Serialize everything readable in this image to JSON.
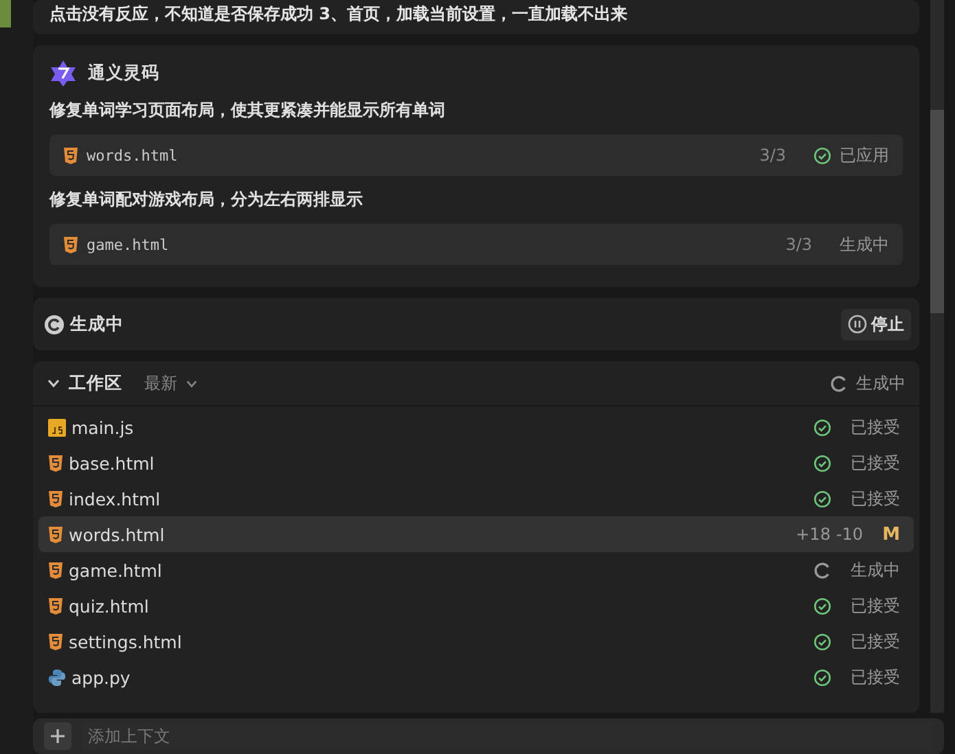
{
  "message": {
    "text": "点击没有反应，不知道是否保存成功 3、首页，加载当前设置，一直加载不出来"
  },
  "reply": {
    "author": "通义灵码",
    "tasks": [
      {
        "title": "修复单词学习页面布局，使其更紧凑并能显示所有单词",
        "file": "words.html",
        "count": "3/3",
        "status": "已应用",
        "kind": "applied"
      },
      {
        "title": "修复单词配对游戏布局，分为左右两排显示",
        "file": "game.html",
        "count": "3/3",
        "status": "生成中",
        "kind": "generating"
      }
    ]
  },
  "status_bar": {
    "label": "生成中",
    "stop": "停止"
  },
  "workspace": {
    "title": "工作区",
    "sort": "最新",
    "expanded": true,
    "status": "生成中",
    "files": [
      {
        "name": "main.js",
        "kind": "js",
        "status": {
          "kind": "accepted",
          "text": "已接受"
        },
        "selected": false
      },
      {
        "name": "base.html",
        "kind": "html",
        "status": {
          "kind": "accepted",
          "text": "已接受"
        },
        "selected": false
      },
      {
        "name": "index.html",
        "kind": "html",
        "status": {
          "kind": "accepted",
          "text": "已接受"
        },
        "selected": false
      },
      {
        "name": "words.html",
        "kind": "html",
        "status": {
          "kind": "modified",
          "added": "+18",
          "removed": "-10",
          "badge": "M"
        },
        "selected": true
      },
      {
        "name": "game.html",
        "kind": "html",
        "status": {
          "kind": "generating",
          "text": "生成中"
        },
        "selected": false
      },
      {
        "name": "quiz.html",
        "kind": "html",
        "status": {
          "kind": "accepted",
          "text": "已接受"
        },
        "selected": false
      },
      {
        "name": "settings.html",
        "kind": "html",
        "status": {
          "kind": "accepted",
          "text": "已接受"
        },
        "selected": false
      },
      {
        "name": "app.py",
        "kind": "py",
        "status": {
          "kind": "accepted",
          "text": "已接受"
        },
        "selected": false
      }
    ]
  },
  "input": {
    "placeholder": "添加上下文"
  }
}
